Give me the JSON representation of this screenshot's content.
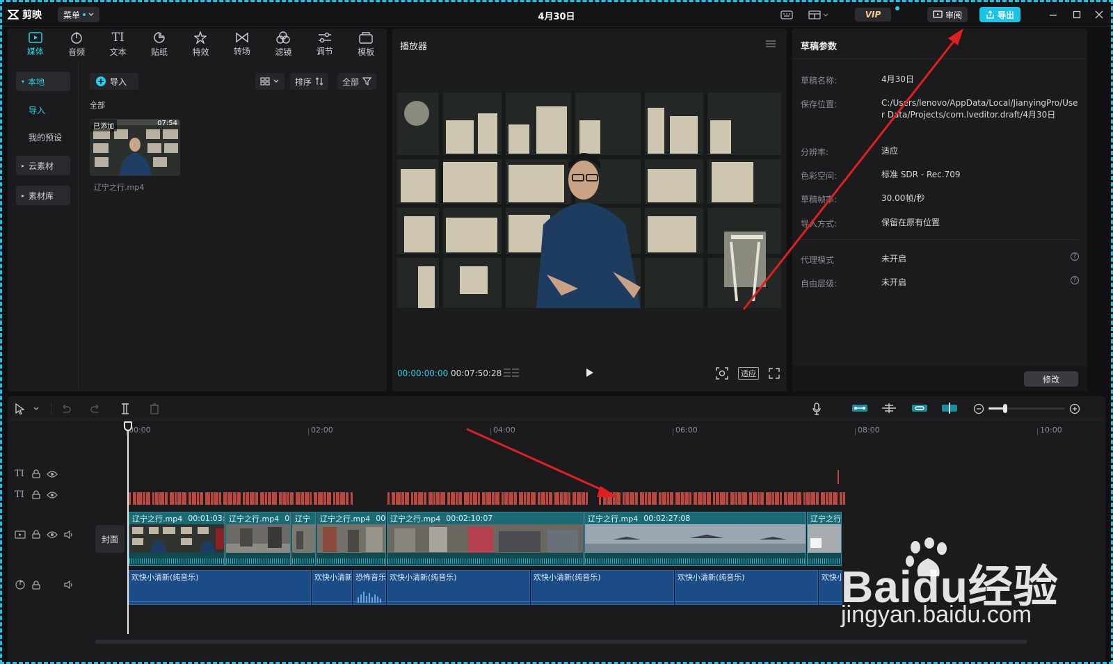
{
  "app": {
    "name": "剪映",
    "menu_label": "菜单",
    "draft_title": "4月30日"
  },
  "titlebar": {
    "vip_label": "VIP",
    "review_label": "审阅",
    "export_label": "导出"
  },
  "tools": [
    {
      "label": "媒体",
      "icon": "media-icon"
    },
    {
      "label": "音频",
      "icon": "audio-icon"
    },
    {
      "label": "文本",
      "icon": "text-icon"
    },
    {
      "label": "贴纸",
      "icon": "sticker-icon"
    },
    {
      "label": "特效",
      "icon": "effects-icon"
    },
    {
      "label": "转场",
      "icon": "transition-icon"
    },
    {
      "label": "滤镜",
      "icon": "filter-icon"
    },
    {
      "label": "调节",
      "icon": "adjust-icon"
    },
    {
      "label": "模板",
      "icon": "template-icon"
    }
  ],
  "text_tool_glyph": "TI",
  "left_nav": {
    "local": "本地",
    "import": "导入",
    "presets": "我的预设",
    "cloud": "云素材",
    "library": "素材库"
  },
  "media": {
    "import_label": "导入",
    "sort_label": "排序",
    "filter_label": "全部",
    "all_label": "全部",
    "item": {
      "badge": "已添加",
      "duration": "07:54",
      "name": "辽宁之行.mp4"
    }
  },
  "player": {
    "title": "播放器",
    "current_time": "00:00:00:00",
    "total_time": "00:07:50:28",
    "fit_label": "适应"
  },
  "params": {
    "title": "草稿参数",
    "rows": [
      {
        "label": "草稿名称:",
        "value": "4月30日"
      },
      {
        "label": "保存位置:",
        "value": "C:/Users/lenovo/AppData/Local/JianyingPro/User Data/Projects/com.lveditor.draft/4月30日"
      },
      {
        "label": "分辨率:",
        "value": "适应"
      },
      {
        "label": "色彩空间:",
        "value": "标准 SDR - Rec.709"
      },
      {
        "label": "草稿帧率:",
        "value": "30.00帧/秒"
      },
      {
        "label": "导入方式:",
        "value": "保留在原有位置"
      },
      {
        "label": "代理模式",
        "value": "未开启"
      },
      {
        "label": "自由层级:",
        "value": "未开启"
      }
    ],
    "edit_label": "修改"
  },
  "timeline": {
    "ruler": [
      "00:00",
      "02:00",
      "04:00",
      "06:00",
      "08:00",
      "10:00"
    ],
    "cover_label": "封面",
    "video_clips": [
      {
        "name": "辽宁之行.mp4",
        "time": "00:01:03:0"
      },
      {
        "name": "辽宁之行.mp4",
        "time": "0"
      },
      {
        "name": "辽宁",
        "time": ""
      },
      {
        "name": "辽宁之行.mp4",
        "time": "00:"
      },
      {
        "name": "辽宁之行.mp4",
        "time": "00:02:10:07"
      },
      {
        "name": "辽宁之行.mp4",
        "time": "00:02:27:08"
      },
      {
        "name": "辽宁之行",
        "time": ""
      }
    ],
    "audio_clips": [
      "欢快小清新(纯音乐)",
      "欢快小清新",
      "恐怖音乐",
      "欢快小清新(纯音乐)",
      "欢快小清新(纯音乐)",
      "欢快小清新(纯音乐)",
      "欢快小"
    ]
  },
  "watermark": {
    "brand": "Baidu经验",
    "url": "jingyan.baidu.com"
  },
  "colors": {
    "accent": "#19c4e6",
    "video_clip": "#155b66",
    "audio_clip": "#1b4c86",
    "text_track": "#b9483e",
    "annotation_arrow": "#e02020"
  }
}
